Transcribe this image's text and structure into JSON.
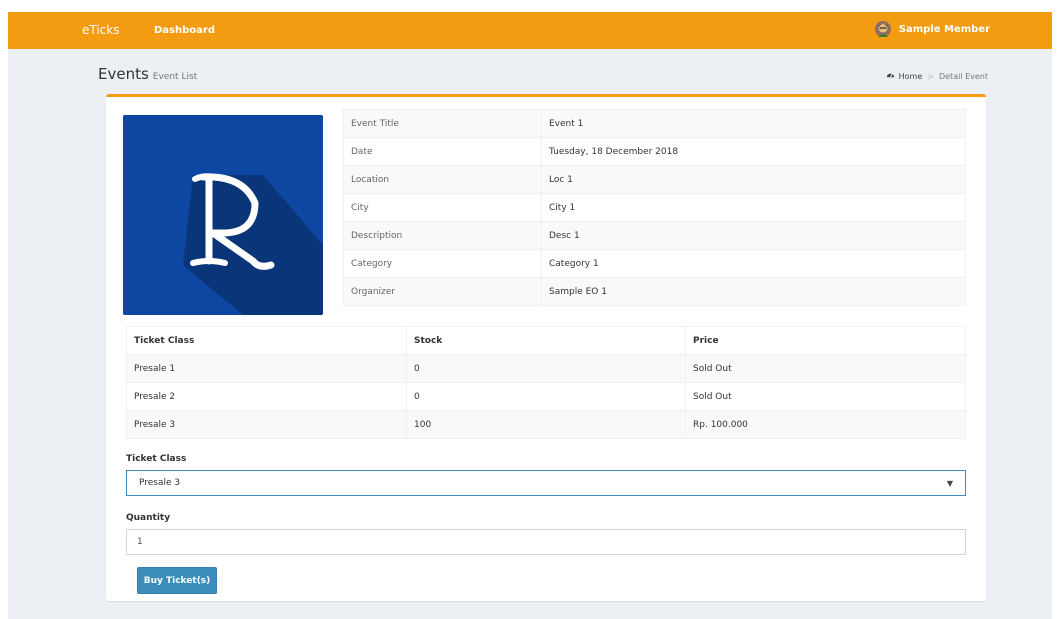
{
  "navbar": {
    "brand": "eTicks",
    "dashboard_link": "Dashboard",
    "user_name": "Sample Member",
    "avatar_icon": "user-avatar-icon"
  },
  "header": {
    "title": "Events",
    "subtitle": "Event List",
    "breadcrumb": {
      "home": "Home",
      "current": "Detail Event",
      "home_icon": "dashboard-icon"
    }
  },
  "event_image": {
    "letter": "R",
    "bg_color": "#0d47a1"
  },
  "details": [
    {
      "label": "Event Title",
      "value": "Event 1"
    },
    {
      "label": "Date",
      "value": "Tuesday, 18 December 2018"
    },
    {
      "label": "Location",
      "value": "Loc 1"
    },
    {
      "label": "City",
      "value": "City 1"
    },
    {
      "label": "Description",
      "value": "Desc 1"
    },
    {
      "label": "Category",
      "value": "Category 1"
    },
    {
      "label": "Organizer",
      "value": "Sample EO 1"
    }
  ],
  "tickets": {
    "headers": [
      "Ticket Class",
      "Stock",
      "Price"
    ],
    "rows": [
      [
        "Presale 1",
        "0",
        "Sold Out"
      ],
      [
        "Presale 2",
        "0",
        "Sold Out"
      ],
      [
        "Presale 3",
        "100",
        "Rp. 100.000"
      ]
    ]
  },
  "form": {
    "ticket_class_label": "Ticket Class",
    "ticket_class_value": "Presale 3",
    "quantity_label": "Quantity",
    "quantity_value": "1",
    "buy_button": "Buy Ticket(s)"
  },
  "colors": {
    "accent": "#f39c12",
    "primary": "#3c8dbc",
    "background": "#ecf0f5"
  }
}
